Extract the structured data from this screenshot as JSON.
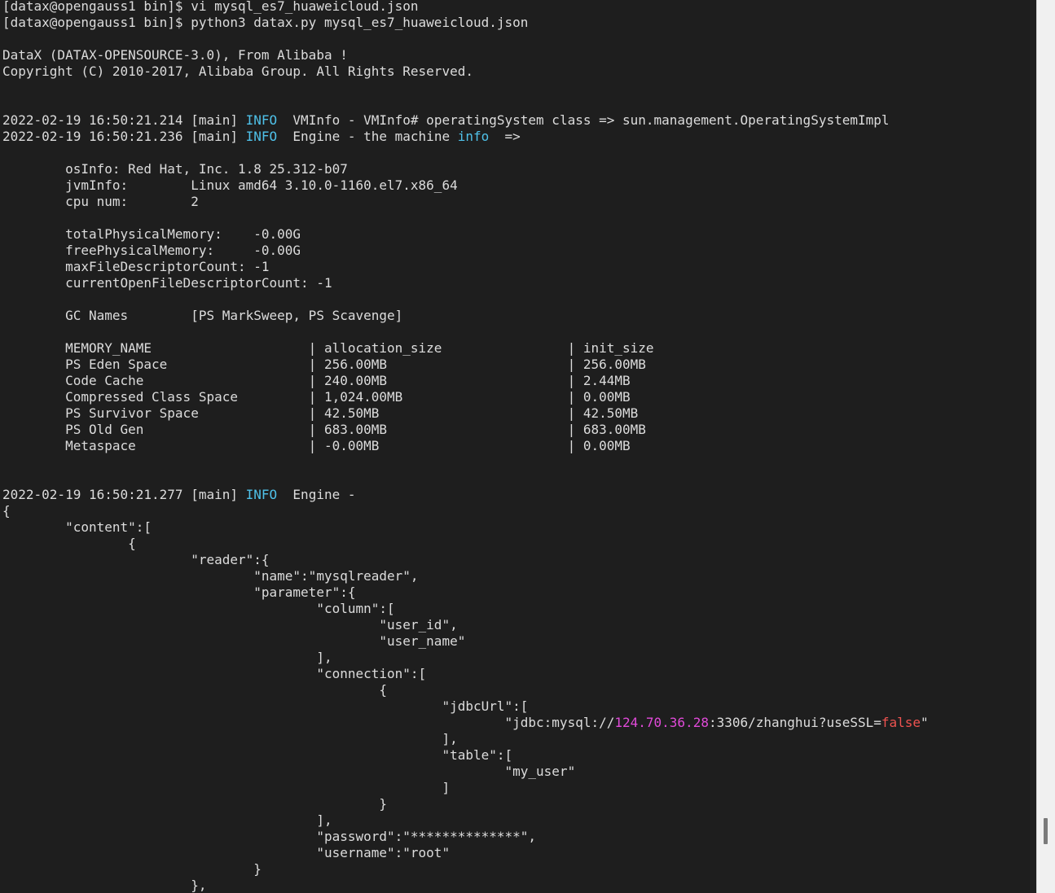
{
  "colors": {
    "background": "#1e1e1e",
    "text": "#dcdcdc",
    "info": "#4fc1e9",
    "ip": "#e14ad9",
    "bool": "#ef5350"
  },
  "terminal": {
    "lines": [
      [
        {
          "t": "[datax@opengauss1 bin]$ vi mysql_es7_huaweicloud.json"
        }
      ],
      [
        {
          "t": "[datax@opengauss1 bin]$ python3 datax.py mysql_es7_huaweicloud.json"
        }
      ],
      [
        {
          "t": ""
        }
      ],
      [
        {
          "t": "DataX (DATAX-OPENSOURCE-3.0), From Alibaba !"
        }
      ],
      [
        {
          "t": "Copyright (C) 2010-2017, Alibaba Group. All Rights Reserved."
        }
      ],
      [
        {
          "t": ""
        }
      ],
      [
        {
          "t": ""
        }
      ],
      [
        {
          "t": "2022-02-19 16:50:21.214 [main] "
        },
        {
          "t": "INFO",
          "c": "info"
        },
        {
          "t": "  VMInfo - VMInfo# operatingSystem class => sun.management.OperatingSystemImpl"
        }
      ],
      [
        {
          "t": "2022-02-19 16:50:21.236 [main] "
        },
        {
          "t": "INFO",
          "c": "info"
        },
        {
          "t": "  Engine - the machine "
        },
        {
          "t": "info",
          "c": "info"
        },
        {
          "t": "  =>"
        }
      ],
      [
        {
          "t": ""
        }
      ],
      [
        {
          "t": "        osInfo: Red Hat, Inc. 1.8 25.312-b07"
        }
      ],
      [
        {
          "t": "        jvmInfo:        Linux amd64 3.10.0-1160.el7.x86_64"
        }
      ],
      [
        {
          "t": "        cpu num:        2"
        }
      ],
      [
        {
          "t": ""
        }
      ],
      [
        {
          "t": "        totalPhysicalMemory:    -0.00G"
        }
      ],
      [
        {
          "t": "        freePhysicalMemory:     -0.00G"
        }
      ],
      [
        {
          "t": "        maxFileDescriptorCount: -1"
        }
      ],
      [
        {
          "t": "        currentOpenFileDescriptorCount: -1"
        }
      ],
      [
        {
          "t": ""
        }
      ],
      [
        {
          "t": "        GC Names        [PS MarkSweep, PS Scavenge]"
        }
      ],
      [
        {
          "t": ""
        }
      ],
      [
        {
          "t": "        MEMORY_NAME                    | allocation_size                | init_size"
        }
      ],
      [
        {
          "t": "        PS Eden Space                  | 256.00MB                       | 256.00MB"
        }
      ],
      [
        {
          "t": "        Code Cache                     | 240.00MB                       | 2.44MB"
        }
      ],
      [
        {
          "t": "        Compressed Class Space         | 1,024.00MB                     | 0.00MB"
        }
      ],
      [
        {
          "t": "        PS Survivor Space              | 42.50MB                        | 42.50MB"
        }
      ],
      [
        {
          "t": "        PS Old Gen                     | 683.00MB                       | 683.00MB"
        }
      ],
      [
        {
          "t": "        Metaspace                      | -0.00MB                        | 0.00MB"
        }
      ],
      [
        {
          "t": ""
        }
      ],
      [
        {
          "t": ""
        }
      ],
      [
        {
          "t": "2022-02-19 16:50:21.277 [main] "
        },
        {
          "t": "INFO",
          "c": "info"
        },
        {
          "t": "  Engine -"
        }
      ],
      [
        {
          "t": "{"
        }
      ],
      [
        {
          "t": "        \"content\":["
        }
      ],
      [
        {
          "t": "                {"
        }
      ],
      [
        {
          "t": "                        \"reader\":{"
        }
      ],
      [
        {
          "t": "                                \"name\":\"mysqlreader\","
        }
      ],
      [
        {
          "t": "                                \"parameter\":{"
        }
      ],
      [
        {
          "t": "                                        \"column\":["
        }
      ],
      [
        {
          "t": "                                                \"user_id\","
        }
      ],
      [
        {
          "t": "                                                \"user_name\""
        }
      ],
      [
        {
          "t": "                                        ],"
        }
      ],
      [
        {
          "t": "                                        \"connection\":["
        }
      ],
      [
        {
          "t": "                                                {"
        }
      ],
      [
        {
          "t": "                                                        \"jdbcUrl\":["
        }
      ],
      [
        {
          "t": "                                                                \"jdbc:mysql://"
        },
        {
          "t": "124.70.36.28",
          "c": "ip"
        },
        {
          "t": ":3306/zhanghui?useSSL="
        },
        {
          "t": "false",
          "c": "bool"
        },
        {
          "t": "\""
        }
      ],
      [
        {
          "t": "                                                        ],"
        }
      ],
      [
        {
          "t": "                                                        \"table\":["
        }
      ],
      [
        {
          "t": "                                                                \"my_user\""
        }
      ],
      [
        {
          "t": "                                                        ]"
        }
      ],
      [
        {
          "t": "                                                }"
        }
      ],
      [
        {
          "t": "                                        ],"
        }
      ],
      [
        {
          "t": "                                        \"password\":\"**************\","
        }
      ],
      [
        {
          "t": "                                        \"username\":\"root\""
        }
      ],
      [
        {
          "t": "                                }"
        }
      ],
      [
        {
          "t": "                        },"
        }
      ]
    ]
  }
}
